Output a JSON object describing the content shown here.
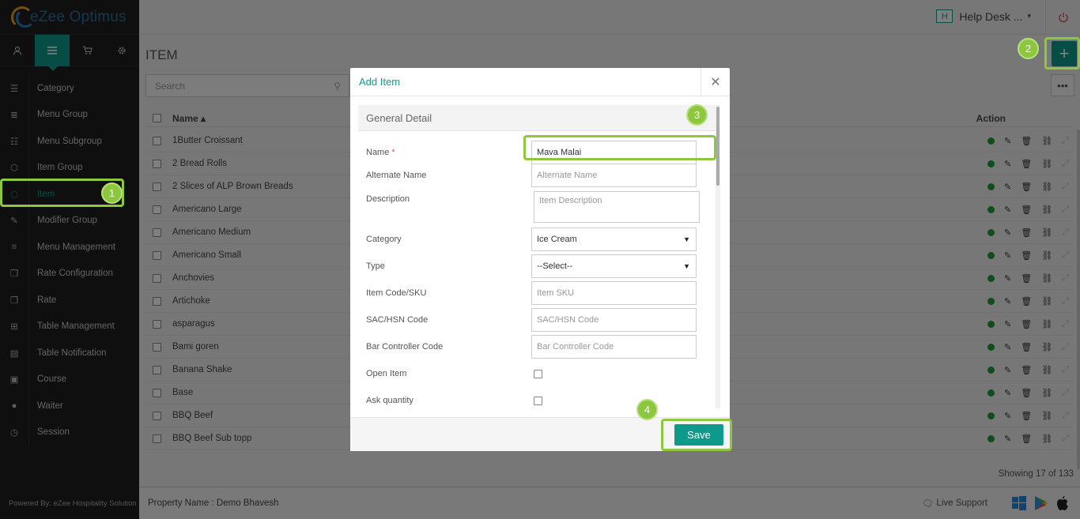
{
  "app": {
    "logo_text": "eZee Optimus",
    "footer_powered": "Powered By: eZee Hospitality Solution"
  },
  "header": {
    "help_badge": "H",
    "help_label": "Help Desk ...",
    "help_caret": "▾"
  },
  "sidebar": {
    "tabs": [
      {
        "icon": "user-icon"
      },
      {
        "icon": "menu-list-icon",
        "active": true
      },
      {
        "icon": "cart-icon"
      },
      {
        "icon": "gear-icon"
      }
    ],
    "items": [
      {
        "label": "Category",
        "icon": "category-icon"
      },
      {
        "label": "Menu Group",
        "icon": "list-icon"
      },
      {
        "label": "Menu Subgroup",
        "icon": "sublist-icon"
      },
      {
        "label": "Item Group",
        "icon": "cube-icon"
      },
      {
        "label": "Item",
        "icon": "box-icon",
        "active": true
      },
      {
        "label": "Modifier Group",
        "icon": "edit-icon"
      },
      {
        "label": "Menu Management",
        "icon": "bars-icon"
      },
      {
        "label": "Rate Configuration",
        "icon": "copy-icon"
      },
      {
        "label": "Rate",
        "icon": "copy-icon"
      },
      {
        "label": "Table Management",
        "icon": "grid-icon"
      },
      {
        "label": "Table Notification",
        "icon": "message-icon"
      },
      {
        "label": "Course",
        "icon": "book-icon"
      },
      {
        "label": "Waiter",
        "icon": "person-icon"
      },
      {
        "label": "Session",
        "icon": "timer-icon"
      }
    ]
  },
  "main": {
    "title": "ITEM",
    "add_symbol": "+",
    "more_symbol": "•••",
    "search_placeholder": "Search",
    "col_name": "Name ▴",
    "col_action": "Action",
    "rows": [
      "1Butter Croissant",
      "2 Bread Rolls",
      "2 Slices of ALP Brown Breads",
      "Americano Large",
      "Americano Medium",
      "Americano Small",
      "Anchovies",
      "Artichoke",
      "asparagus",
      "Bami goren",
      "Banana Shake",
      "Base",
      "BBQ Beef",
      "BBQ Beef Sub topp"
    ],
    "showing": "Showing 17 of 133"
  },
  "footer": {
    "property": "Property Name : Demo Bhavesh",
    "live_support": "Live Support"
  },
  "modal": {
    "title": "Add Item",
    "close_symbol": "✕",
    "section": "General Detail",
    "fields": {
      "name_label": "Name",
      "name_required": "*",
      "name_value": "Mava Malai",
      "alt_label": "Alternate Name",
      "alt_placeholder": "Alternate Name",
      "desc_label": "Description",
      "desc_placeholder": "Item Description",
      "category_label": "Category",
      "category_value": "Ice Cream",
      "type_label": "Type",
      "type_value": "--Select--",
      "sku_label": "Item Code/SKU",
      "sku_placeholder": "Item SKU",
      "sac_label": "SAC/HSN Code",
      "sac_placeholder": "SAC/HSN Code",
      "bar_label": "Bar Controller Code",
      "bar_placeholder": "Bar Controller Code",
      "open_label": "Open Item",
      "ask_label": "Ask quantity"
    },
    "save_label": "Save"
  },
  "annotations": {
    "b1": "1",
    "b2": "2",
    "b3": "3",
    "b4": "4",
    "color": "#8dc63f"
  }
}
